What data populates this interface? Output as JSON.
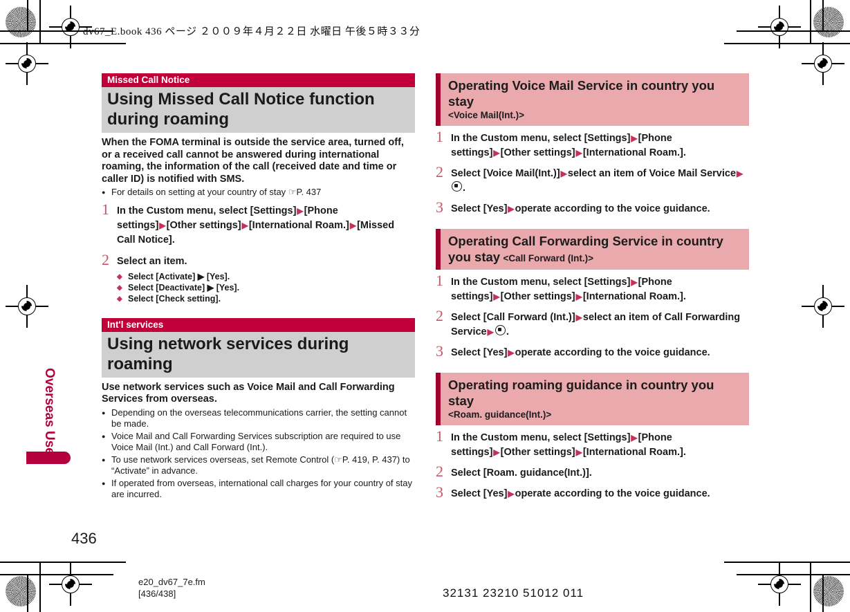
{
  "page": {
    "slug": "dv67_E.book  436 ページ  ２００９年４月２２日  水曜日  午後５時３３分",
    "number": "436",
    "filename": "e20_dv67_7e.fm",
    "page_range": "[436/438]",
    "barcode_text": "32131 23210 51012 011",
    "thumb_tab": "Overseas Use",
    "colors": {
      "accent_red": "#c10039",
      "dark_red": "#9e0030",
      "pink": "#e9a9ad",
      "gray": "#cfcfcf",
      "step_number": "#c4556b",
      "arrow": "#c4325a"
    }
  },
  "left_column": {
    "section1": {
      "tag": "Missed Call Notice",
      "title": "Using Missed Call Notice function during roaming",
      "lead": "When the FOMA terminal is outside the service area, turned off, or a received call cannot be answered during international roaming, the information of the call (received date and time or caller ID) is notified with SMS.",
      "bullets": [
        "For details on setting at your country of stay ☞P. 437"
      ],
      "steps": [
        {
          "num": "1",
          "parts": [
            "In the Custom menu, select [Settings]",
            "[Phone settings]",
            "[Other settings]",
            "[International Roam.]",
            "[Missed Call Notice]."
          ]
        },
        {
          "num": "2",
          "parts": [
            "Select an item."
          ],
          "options": [
            "Select [Activate] ▶ [Yes].",
            "Select [Deactivate] ▶ [Yes].",
            "Select [Check setting]."
          ]
        }
      ]
    },
    "section2": {
      "tag": "Int'l services",
      "title": "Using network services during roaming",
      "lead": "Use network services such as Voice Mail and Call Forwarding Services from overseas.",
      "bullets": [
        "Depending on the overseas telecommunications carrier, the setting cannot be made.",
        "Voice Mail and Call Forwarding Services subscription are required to use Voice Mail (Int.) and Call Forward (Int.).",
        "To use network services overseas, set Remote Control (☞P. 419, P. 437) to “Activate” in advance.",
        "If operated from overseas, international call charges for your country of stay are incurred."
      ]
    }
  },
  "right_column": {
    "block1": {
      "heading": "Operating Voice Mail Service in country you stay",
      "subheading": "<Voice Mail(Int.)>",
      "inline": false,
      "steps": [
        {
          "num": "1",
          "p1": "In the Custom menu, select [Settings]",
          "p2": "[Phone settings]",
          "p3": "[Other settings]",
          "p4": "[International Roam.]."
        },
        {
          "num": "2",
          "p1": "Select [Voice Mail(Int.)]",
          "p2": "select an item of Voice Mail Service",
          "p3": "."
        },
        {
          "num": "3",
          "p1": "Select [Yes]",
          "p2": "operate according to the voice guidance."
        }
      ]
    },
    "block2": {
      "heading": "Operating Call Forwarding Service in country you stay",
      "subheading": "<Call Forward (Int.)>",
      "inline": true,
      "steps": [
        {
          "num": "1",
          "p1": "In the Custom menu, select [Settings]",
          "p2": "[Phone settings]",
          "p3": "[Other settings]",
          "p4": "[International Roam.]."
        },
        {
          "num": "2",
          "p1": "Select [Call Forward (Int.)]",
          "p2": "select an item of Call Forwarding Service",
          "p3": "."
        },
        {
          "num": "3",
          "p1": "Select [Yes]",
          "p2": "operate according to the voice guidance."
        }
      ]
    },
    "block3": {
      "heading": "Operating roaming guidance in country you stay",
      "subheading": "<Roam. guidance(Int.)>",
      "inline": false,
      "steps": [
        {
          "num": "1",
          "p1": "In the Custom menu, select [Settings]",
          "p2": "[Phone settings]",
          "p3": "[Other settings]",
          "p4": "[International Roam.]."
        },
        {
          "num": "2",
          "p1": "Select [Roam. guidance(Int.)].",
          "p2": "",
          "p3": ""
        },
        {
          "num": "3",
          "p1": "Select [Yes]",
          "p2": "operate according to the voice guidance."
        }
      ]
    }
  }
}
